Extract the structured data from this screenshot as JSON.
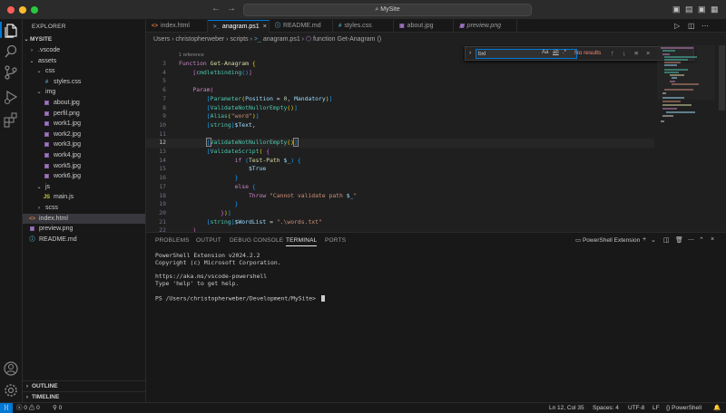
{
  "window": {
    "title": "MySite"
  },
  "activity_bar": {
    "items": [
      "explorer",
      "search",
      "source-control",
      "run-debug",
      "extensions"
    ],
    "bottom": [
      "accounts",
      "manage"
    ]
  },
  "explorer": {
    "title": "EXPLORER",
    "root": "MYSITE",
    "items": [
      {
        "label": ".vscode",
        "icon": "chevron-right"
      },
      {
        "label": "assets",
        "icon": "chevron-down"
      },
      {
        "label": "css",
        "icon": "chevron-down"
      },
      {
        "label": "styles.css",
        "icon": "#"
      },
      {
        "label": "img",
        "icon": "chevron-down"
      },
      {
        "label": "about.jpg",
        "icon": "image"
      },
      {
        "label": "perfil.png",
        "icon": "image"
      },
      {
        "label": "work1.jpg",
        "icon": "image"
      },
      {
        "label": "work2.jpg",
        "icon": "image"
      },
      {
        "label": "work3.jpg",
        "icon": "image"
      },
      {
        "label": "work4.jpg",
        "icon": "image"
      },
      {
        "label": "work5.jpg",
        "icon": "image"
      },
      {
        "label": "work6.jpg",
        "icon": "image"
      },
      {
        "label": "js",
        "icon": "chevron-down"
      },
      {
        "label": "main.js",
        "icon": "JS"
      },
      {
        "label": "scss",
        "icon": "chevron-right"
      },
      {
        "label": "index.html",
        "icon": "<>"
      },
      {
        "label": "preview.png",
        "icon": "image"
      },
      {
        "label": "README.md",
        "icon": "info"
      }
    ],
    "outline": "OUTLINE",
    "timeline": "TIMELINE"
  },
  "tabs": [
    {
      "label": "index.html",
      "icon": "<>"
    },
    {
      "label": "anagram.ps1",
      "icon": ">_"
    },
    {
      "label": "README.md",
      "icon": "info"
    },
    {
      "label": "styles.css",
      "icon": "#"
    },
    {
      "label": "about.jpg",
      "icon": "image"
    },
    {
      "label": "preview.png",
      "icon": "image"
    }
  ],
  "breadcrumb": [
    "Users",
    "christopherweber",
    "scripts",
    "anagram.ps1",
    "function Get-Anagram ()"
  ],
  "editor": {
    "codelens": "1 reference",
    "current_line": 12,
    "line_numbers": [
      "3",
      "4",
      "5",
      "6",
      "7",
      "8",
      "9",
      "10",
      "11",
      "12",
      "13",
      "14",
      "15",
      "16",
      "17",
      "18",
      "19",
      "20",
      "21",
      "22"
    ]
  },
  "find_widget": {
    "value": "bxl",
    "result": "No results",
    "options": [
      "Aa",
      "ab",
      ".*"
    ]
  },
  "panel": {
    "tabs": [
      "PROBLEMS",
      "OUTPUT",
      "DEBUG CONSOLE",
      "TERMINAL",
      "PORTS"
    ],
    "active_tab": "TERMINAL",
    "terminal_name": "PowerShell Extension",
    "terminal_lines": [
      "PowerShell Extension v2024.2.2",
      "Copyright (c) Microsoft Corporation.",
      "",
      "https://aka.ms/vscode-powershell",
      "Type 'help' to get help.",
      "",
      "PS /Users/christopherweber/Development/MySite> "
    ]
  },
  "statusbar": {
    "errors": "0",
    "warnings": "0",
    "ports": "0",
    "position": "Ln 12, Col 35",
    "spaces": "Spaces: 4",
    "encoding": "UTF-8",
    "eol": "LF",
    "language": "PowerShell"
  }
}
